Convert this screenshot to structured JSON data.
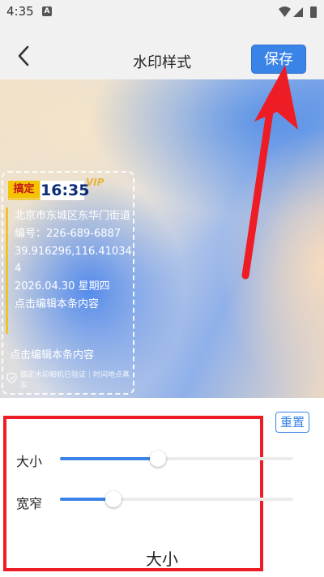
{
  "status_bar": {
    "time": "4:35",
    "app_glyph": "A"
  },
  "header": {
    "title": "水印样式",
    "save_label": "保存"
  },
  "watermark": {
    "logo_text": "搞定",
    "time": "16:35",
    "vip": "VIP",
    "lines": [
      "北京市东城区东华门街道",
      "编号：226-689-6887",
      "39.916296,116.410344",
      "2026.04.30 星期四",
      "点击编辑本条内容"
    ],
    "footer_text": "点击编辑本条内容",
    "verify_text": "搞定水印相机已验证｜时间地点真实"
  },
  "controls": {
    "reset_label": "重置",
    "size_label": "大小",
    "size_value": 0.42,
    "width_label": "宽窄",
    "width_value": 0.23,
    "bottom_label": "大小"
  },
  "colors": {
    "accent": "#3a84e8",
    "highlight_red": "#ee1c24",
    "logo_yellow": "#f4c400"
  },
  "icons": [
    "signal-icon",
    "wifi-icon",
    "battery-icon",
    "back-icon",
    "shield-check-icon"
  ]
}
